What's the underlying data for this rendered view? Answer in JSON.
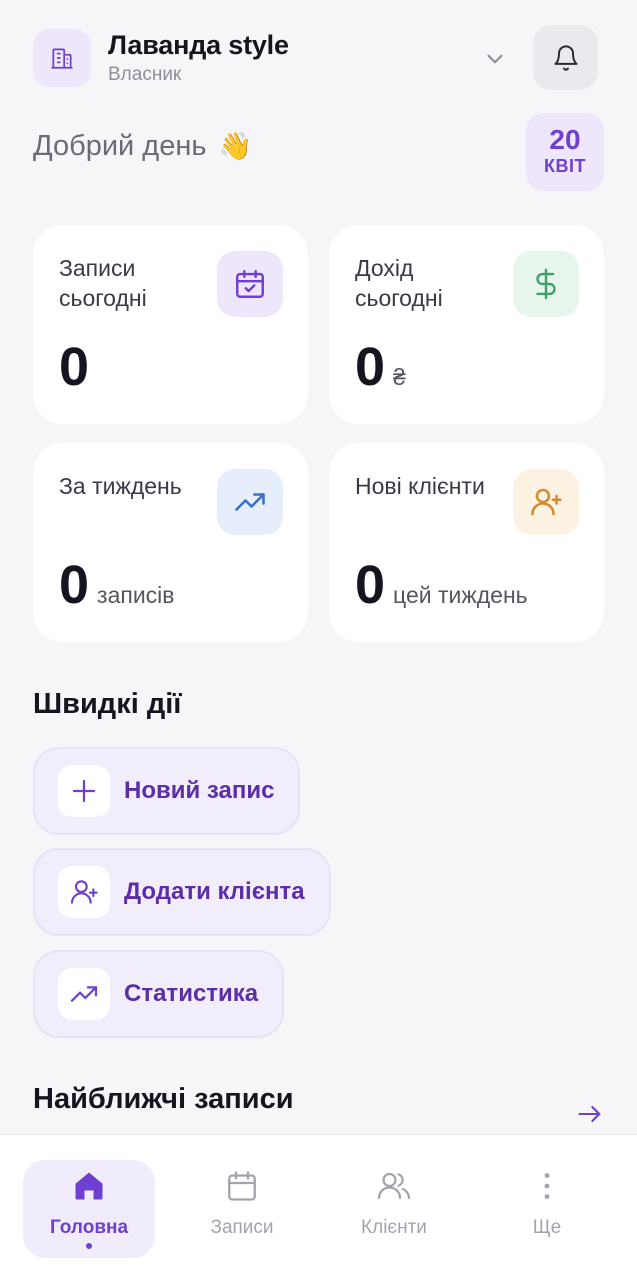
{
  "header": {
    "business_name": "Лаванда style",
    "role": "Власник",
    "greeting": "Добрий день",
    "greeting_emoji": "👋",
    "date": {
      "day": "20",
      "month": "КВІТ"
    }
  },
  "stats": [
    {
      "label": "Записи сьогодні",
      "value": "0",
      "unit": "",
      "icon": "calendar-check-icon",
      "accent": "#6E3FD0"
    },
    {
      "label": "Дохід сьогодні",
      "value": "0",
      "unit": "₴",
      "icon": "dollar-icon",
      "accent": "#3FA06A"
    },
    {
      "label": "За тиждень",
      "value": "0",
      "unit": "записів",
      "icon": "trending-up-icon",
      "accent": "#3D6FC7"
    },
    {
      "label": "Нові клієнти",
      "value": "0",
      "unit": "цей тиждень",
      "icon": "user-plus-icon",
      "accent": "#D48A2E"
    }
  ],
  "quick_actions": {
    "title": "Швидкі дії",
    "items": [
      {
        "label": "Новий запис",
        "icon": "plus-icon"
      },
      {
        "label": "Додати клієнта",
        "icon": "user-plus-icon"
      },
      {
        "label": "Статистика",
        "icon": "trending-up-icon"
      }
    ]
  },
  "upcoming": {
    "title": "Найближчі записи"
  },
  "nav": [
    {
      "label": "Головна",
      "icon": "home-icon",
      "active": true
    },
    {
      "label": "Записи",
      "icon": "calendar-icon",
      "active": false
    },
    {
      "label": "Клієнти",
      "icon": "users-icon",
      "active": false
    },
    {
      "label": "Ще",
      "icon": "more-vertical-icon",
      "active": false
    }
  ],
  "colors": {
    "accent": "#6E3FD0",
    "background": "#F6F6F9",
    "text": "#15151F"
  }
}
